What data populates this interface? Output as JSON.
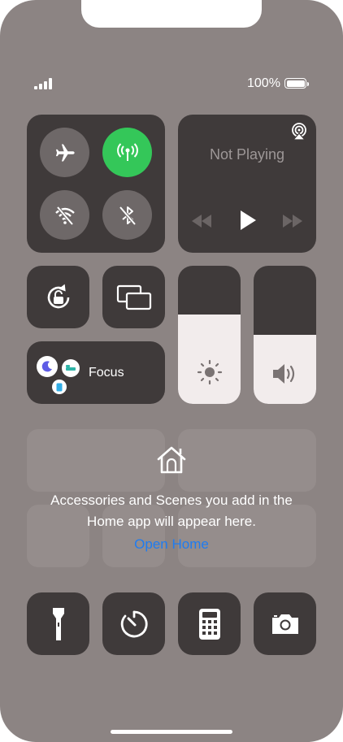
{
  "status": {
    "battery_text": "100%"
  },
  "connectivity": {
    "airplane_on": false,
    "cellular_on": true,
    "wifi_on": false,
    "bluetooth_on": false
  },
  "now_playing": {
    "title": "Not Playing"
  },
  "sliders": {
    "brightness_level": 0.65,
    "volume_level": 0.5
  },
  "focus": {
    "label": "Focus"
  },
  "home": {
    "message_line1": "Accessories and Scenes you add in the",
    "message_line2": "Home app will appear here.",
    "link": "Open Home"
  },
  "colors": {
    "accent_green": "#34c759",
    "link_blue": "#1f7cf1",
    "tile": "#3f3a3a"
  },
  "icons": [
    "airplane-icon",
    "cellular-icon",
    "wifi-off-icon",
    "bluetooth-off-icon",
    "airplay-audio-icon",
    "rewind-icon",
    "play-icon",
    "fast-forward-icon",
    "orientation-lock-icon",
    "screen-mirroring-icon",
    "moon-icon",
    "bed-icon",
    "phone-icon",
    "brightness-icon",
    "volume-icon",
    "home-icon",
    "flashlight-icon",
    "timer-icon",
    "calculator-icon",
    "camera-icon"
  ]
}
